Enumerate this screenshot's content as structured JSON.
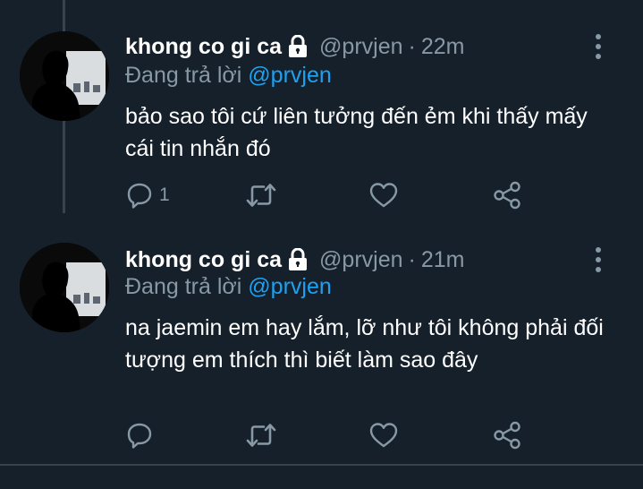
{
  "tweets": [
    {
      "name": "khong co gi ca",
      "handle": "@prvjen",
      "time": "22m",
      "reply_prefix": "Đang trả lời",
      "reply_mention": "@prvjen",
      "text": "bảo sao tôi cứ liên tưởng đến ẻm khi thấy mấy cái tin nhắn đó",
      "reply_count": "1",
      "icons": [
        "lock-icon",
        "more-icon",
        "reply-icon",
        "retweet-icon",
        "like-icon",
        "share-icon"
      ]
    },
    {
      "name": "khong co gi ca",
      "handle": "@prvjen",
      "time": "21m",
      "reply_prefix": "Đang trả lời",
      "reply_mention": "@prvjen",
      "text": "na jaemin em hay lắm, lỡ như tôi không phải đối tượng em thích thì biết làm sao đây",
      "reply_count": "",
      "icons": [
        "lock-icon",
        "more-icon",
        "reply-icon",
        "retweet-icon",
        "like-icon",
        "share-icon"
      ]
    }
  ],
  "separator": "·",
  "colors": {
    "background": "#15202b",
    "muted": "#8899a6",
    "accent": "#1da1f2",
    "divider": "#38444d"
  }
}
